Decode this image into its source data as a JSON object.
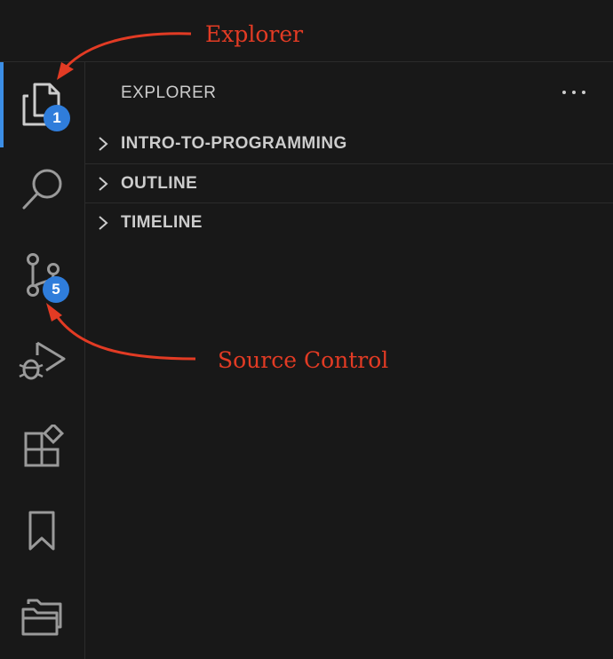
{
  "annotations": {
    "explorer": "Explorer",
    "source_control": "Source Control"
  },
  "activity_bar": {
    "items": [
      {
        "name": "explorer",
        "badge": "1",
        "active": true
      },
      {
        "name": "search"
      },
      {
        "name": "source-control",
        "badge": "5"
      },
      {
        "name": "run-and-debug"
      },
      {
        "name": "extensions"
      },
      {
        "name": "bookmarks"
      },
      {
        "name": "project-manager"
      }
    ]
  },
  "sidebar": {
    "title": "EXPLORER",
    "sections": [
      {
        "label": "INTRO-TO-PROGRAMMING"
      },
      {
        "label": "OUTLINE"
      },
      {
        "label": "TIMELINE"
      }
    ]
  },
  "colors": {
    "annotation": "#e23b24",
    "badge": "#2f7ddb",
    "active_indicator": "#3c8ee6"
  }
}
